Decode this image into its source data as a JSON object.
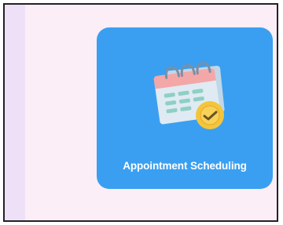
{
  "tile": {
    "label": "Appointment Scheduling",
    "icon": "calendar-clock-icon",
    "background": "#3a9ff0"
  },
  "colors": {
    "page_background": "#fbeef7",
    "side_strip": "#eee0f6",
    "frame_border": "#222222"
  }
}
